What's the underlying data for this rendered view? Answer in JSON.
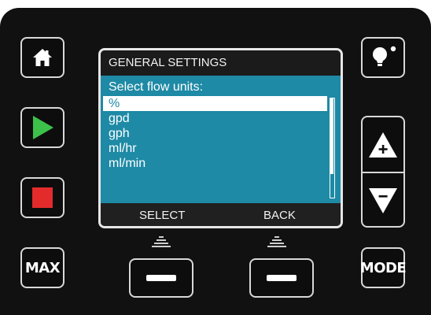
{
  "device": {
    "left_keys": {
      "home": {
        "icon": "home-icon"
      },
      "run": {
        "icon": "play-icon",
        "color": "#3cc24a"
      },
      "stop": {
        "icon": "stop-icon",
        "color": "#e32b2b"
      },
      "max": {
        "label": "MAX"
      }
    },
    "right_keys": {
      "info": {
        "icon": "lightbulb-icon"
      },
      "increase": {
        "icon": "triangle-plus-icon"
      },
      "decrease": {
        "icon": "triangle-minus-icon"
      },
      "mode": {
        "label": "MODE"
      }
    }
  },
  "screen": {
    "title": "GENERAL SETTINGS",
    "prompt": "Select flow units:",
    "options": [
      "%",
      "gpd",
      "gph",
      "ml/hr",
      "ml/min"
    ],
    "selected_option": "%",
    "soft_keys": {
      "left": "SELECT",
      "right": "BACK"
    },
    "colors": {
      "body": "#1e8aa5",
      "title_bar": "#1b1b1b",
      "highlight": "#ffffff"
    }
  }
}
